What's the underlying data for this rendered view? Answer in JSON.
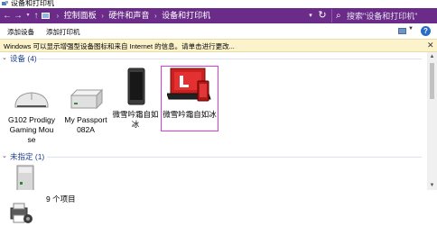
{
  "window": {
    "title": "设备和打印机"
  },
  "address": {
    "breadcrumbs": [
      "控制面板",
      "硬件和声音",
      "设备和打印机"
    ],
    "search_placeholder": "搜索\"设备和打印机\""
  },
  "toolbar": {
    "add_device": "添加设备",
    "add_printer": "添加打印机"
  },
  "infobar": {
    "message": "Windows 可以显示增强型设备图标和来自 Internet 的信息。请单击进行更改..."
  },
  "groups": {
    "devices": {
      "title": "设备 (4)",
      "items": [
        {
          "label": "G102 Prodigy Gaming Mouse",
          "icon": "mouse-icon",
          "selected": false
        },
        {
          "label": "My Passport 082A",
          "icon": "external-drive-icon",
          "selected": false
        },
        {
          "label": "微雪吟霜自如冰",
          "icon": "phone-icon",
          "selected": false
        },
        {
          "label": "微雪吟霜自如冰",
          "icon": "laptop-icon",
          "selected": true
        }
      ]
    },
    "unspecified": {
      "title": "未指定 (1)"
    }
  },
  "status": {
    "item_count": "9 个项目"
  },
  "colors": {
    "address_bar": "#6a2c88",
    "group_title": "#1a3c8e",
    "selection_border": "#d63cd6",
    "infobar": "#fcf3cc"
  }
}
